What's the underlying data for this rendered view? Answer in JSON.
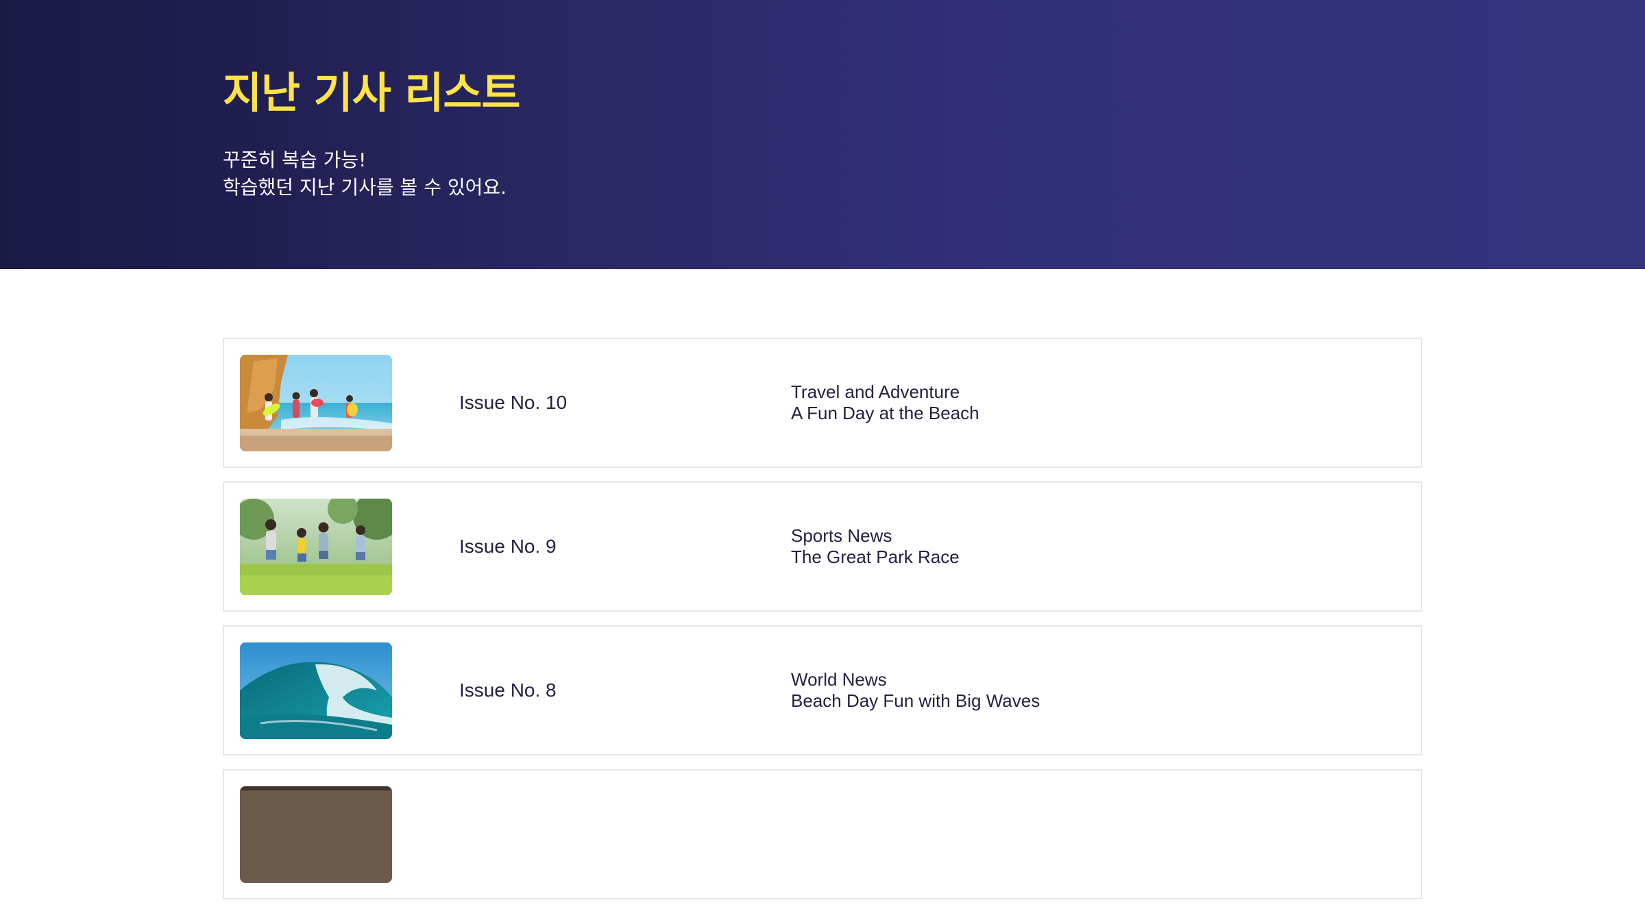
{
  "hero": {
    "title": "지난 기사 리스트",
    "subtitle_line1": "꾸준히 복습 가능!",
    "subtitle_line2": "학습했던 지난 기사를 볼 수 있어요."
  },
  "colors": {
    "hero_bg_start": "#1b1a45",
    "hero_bg_end": "#35327c",
    "title_yellow": "#ffe347",
    "text_dark": "#22223f",
    "card_border": "#e6e6e6"
  },
  "articles": [
    {
      "thumbnail": "beach-kids-image",
      "issue": "Issue No. 10",
      "category": "Travel and Adventure",
      "title": "A Fun Day at the Beach"
    },
    {
      "thumbnail": "park-race-image",
      "issue": "Issue No. 9",
      "category": "Sports News",
      "title": "The Great Park Race"
    },
    {
      "thumbnail": "big-wave-image",
      "issue": "Issue No. 8",
      "category": "World News",
      "title": "Beach Day Fun with Big Waves"
    },
    {
      "thumbnail": "partial-image",
      "issue": "",
      "category": "",
      "title": ""
    }
  ]
}
